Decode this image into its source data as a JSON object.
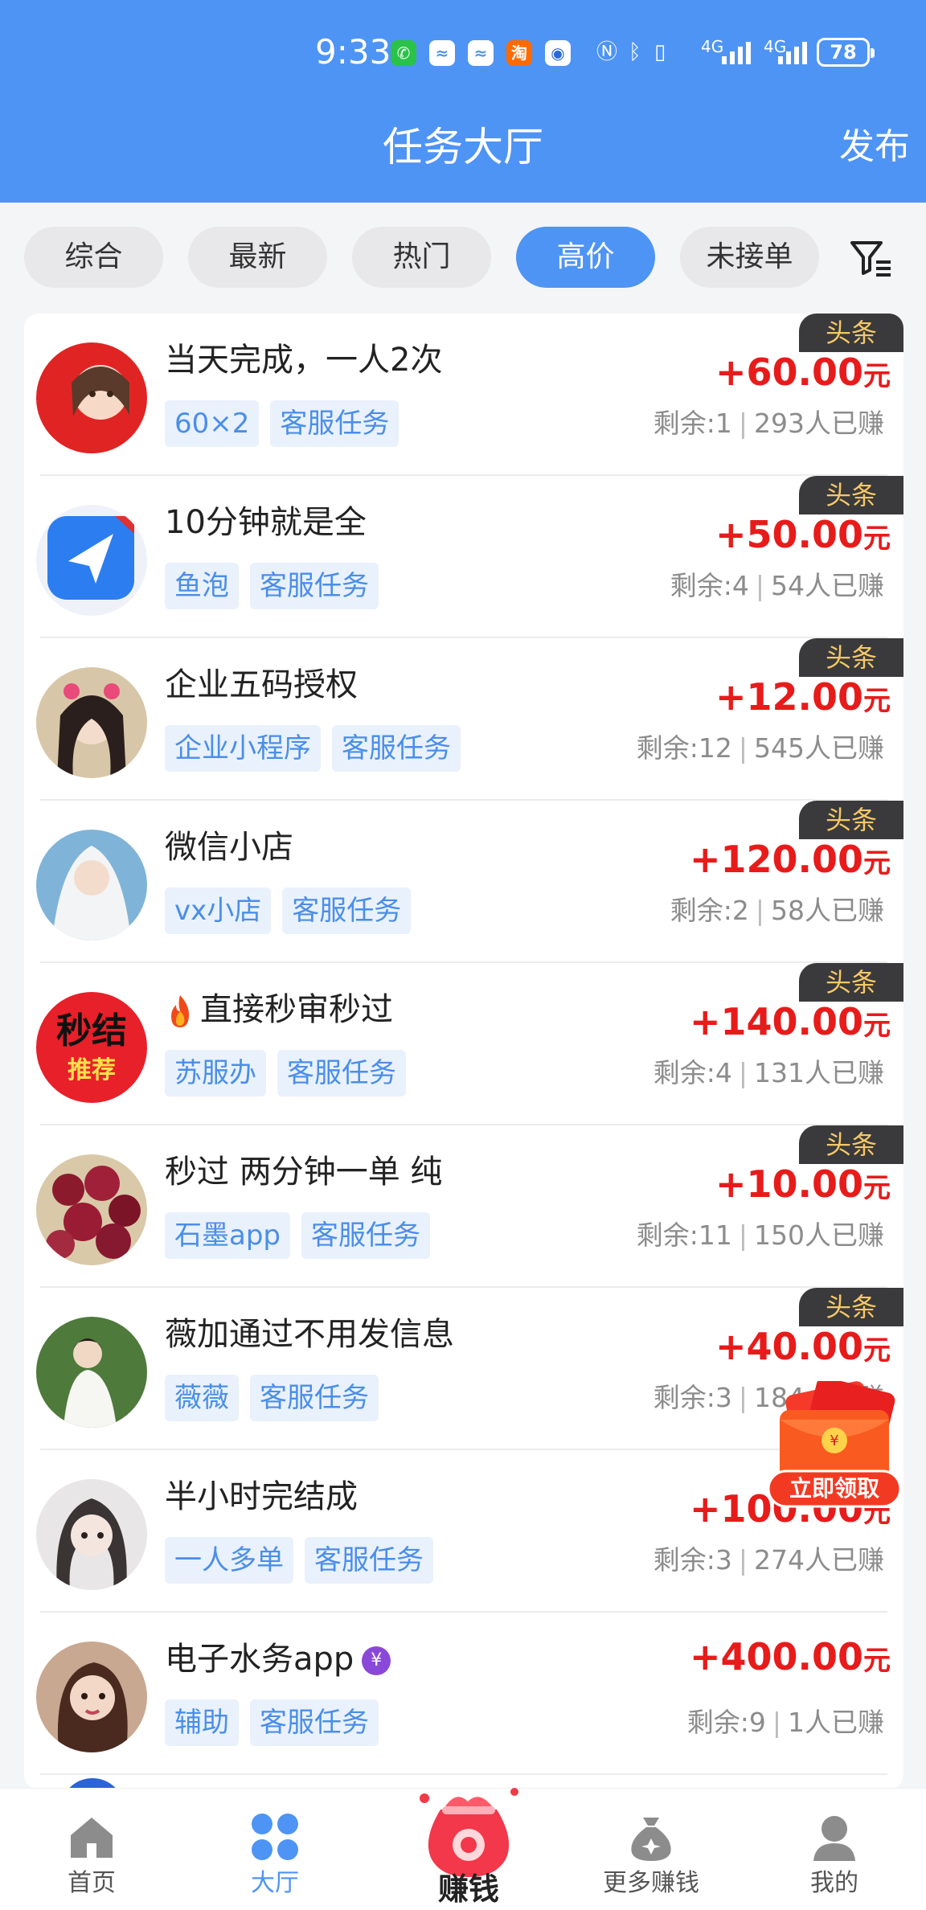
{
  "status_bar": {
    "time": "9:33",
    "battery": "78",
    "network": "4G"
  },
  "header": {
    "title": "任务大厅",
    "publish_label": "发布"
  },
  "filter_tabs": [
    {
      "label": "综合",
      "active": false
    },
    {
      "label": "最新",
      "active": false
    },
    {
      "label": "热门",
      "active": false
    },
    {
      "label": "高价",
      "active": true
    },
    {
      "label": "未接单",
      "active": false
    }
  ],
  "tasks": [
    {
      "title": "当天完成，一人2次",
      "tags": [
        "60×2",
        "客服任务"
      ],
      "price": "+60.00",
      "unit": "元",
      "remaining": "剩余:1",
      "earned": "293人已赚",
      "badge": "头条"
    },
    {
      "title": "10分钟就是全",
      "tags": [
        "鱼泡",
        "客服任务"
      ],
      "price": "+50.00",
      "unit": "元",
      "remaining": "剩余:4",
      "earned": "54人已赚",
      "badge": "头条"
    },
    {
      "title": "企业五码授权",
      "tags": [
        "企业小程序",
        "客服任务"
      ],
      "price": "+12.00",
      "unit": "元",
      "remaining": "剩余:12",
      "earned": "545人已赚",
      "badge": "头条"
    },
    {
      "title": "微信小店",
      "tags": [
        "vx小店",
        "客服任务"
      ],
      "price": "+120.00",
      "unit": "元",
      "remaining": "剩余:2",
      "earned": "58人已赚",
      "badge": "头条"
    },
    {
      "title": "直接秒审秒过",
      "tags": [
        "苏服办",
        "客服任务"
      ],
      "price": "+140.00",
      "unit": "元",
      "remaining": "剩余:4",
      "earned": "131人已赚",
      "badge": "头条",
      "avatar_text": [
        "秒结",
        "推荐"
      ]
    },
    {
      "title": "秒过 两分钟一单 纯",
      "tags": [
        "石墨app",
        "客服任务"
      ],
      "price": "+10.00",
      "unit": "元",
      "remaining": "剩余:11",
      "earned": "150人已赚",
      "badge": "头条"
    },
    {
      "title": "薇加通过不用发信息",
      "tags": [
        "薇薇",
        "客服任务"
      ],
      "price": "+40.00",
      "unit": "元",
      "remaining": "剩余:3",
      "earned": "184人已赚",
      "badge": "头条"
    },
    {
      "title": "半小时完结成",
      "tags": [
        "一人多单",
        "客服任务"
      ],
      "price": "+100.00",
      "unit": "元",
      "remaining": "剩余:3",
      "earned": "274人已赚",
      "badge": ""
    },
    {
      "title": "电子水务app",
      "tags": [
        "辅助",
        "客服任务"
      ],
      "price": "+400.00",
      "unit": "元",
      "remaining": "剩余:9",
      "earned": "1人已赚",
      "badge": "",
      "verified": "¥"
    }
  ],
  "float_packet": {
    "label": "立即领取"
  },
  "bottom_nav": [
    {
      "label": "首页",
      "icon": "home-icon",
      "active": false
    },
    {
      "label": "大厅",
      "icon": "grid-icon",
      "active": true
    },
    {
      "label": "赚钱",
      "icon": "money-bag-icon",
      "active": false
    },
    {
      "label": "更多赚钱",
      "icon": "coin-bag-icon",
      "active": false
    },
    {
      "label": "我的",
      "icon": "user-icon",
      "active": false
    }
  ],
  "colors": {
    "primary": "#4e94f4",
    "price": "#e81b1b",
    "tag_bg": "#e9f1fc",
    "tag_text": "#4a8ee8",
    "badge_bg": "#3a3a3c",
    "badge_text": "#f5c868"
  }
}
